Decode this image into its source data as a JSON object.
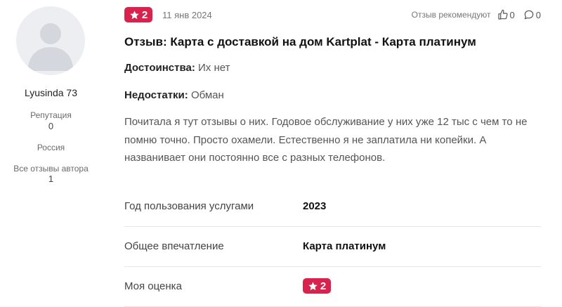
{
  "author": {
    "name": "Lyusinda 73",
    "reputation_label": "Репутация",
    "reputation_value": "0",
    "country": "Россия",
    "all_reviews_label": "Все отзывы автора",
    "all_reviews_count": "1"
  },
  "review": {
    "rating": "2",
    "date": "11 янв 2024",
    "recommend_label": "Отзыв рекомендуют",
    "likes": "0",
    "comments": "0",
    "title": "Отзыв: Карта с доставкой на дом Kartplat - Карта платинум",
    "pros_label": "Достоинства:",
    "pros_value": "Их нет",
    "cons_label": "Недостатки:",
    "cons_value": "Обман",
    "text": "Почитала я тут отзывы о них. Годовое обслуживание у них уже 12 тыс с чем то не помню точно. Просто охамели. Естественно я не заплатила ни копейки. А названивает они постоянно все с разных телефонов."
  },
  "details": {
    "year_label": "Год пользования услугами",
    "year_value": "2023",
    "impression_label": "Общее впечатление",
    "impression_value": "Карта платинум",
    "my_rating_label": "Моя оценка",
    "my_rating_value": "2"
  },
  "colors": {
    "badge": "#d8234e",
    "muted_text": "#777777",
    "divider": "#e6e6e6"
  },
  "icons": {
    "star": "star-icon",
    "like": "thumbs-up-icon",
    "comment": "comment-icon",
    "avatar": "user-placeholder-icon"
  }
}
